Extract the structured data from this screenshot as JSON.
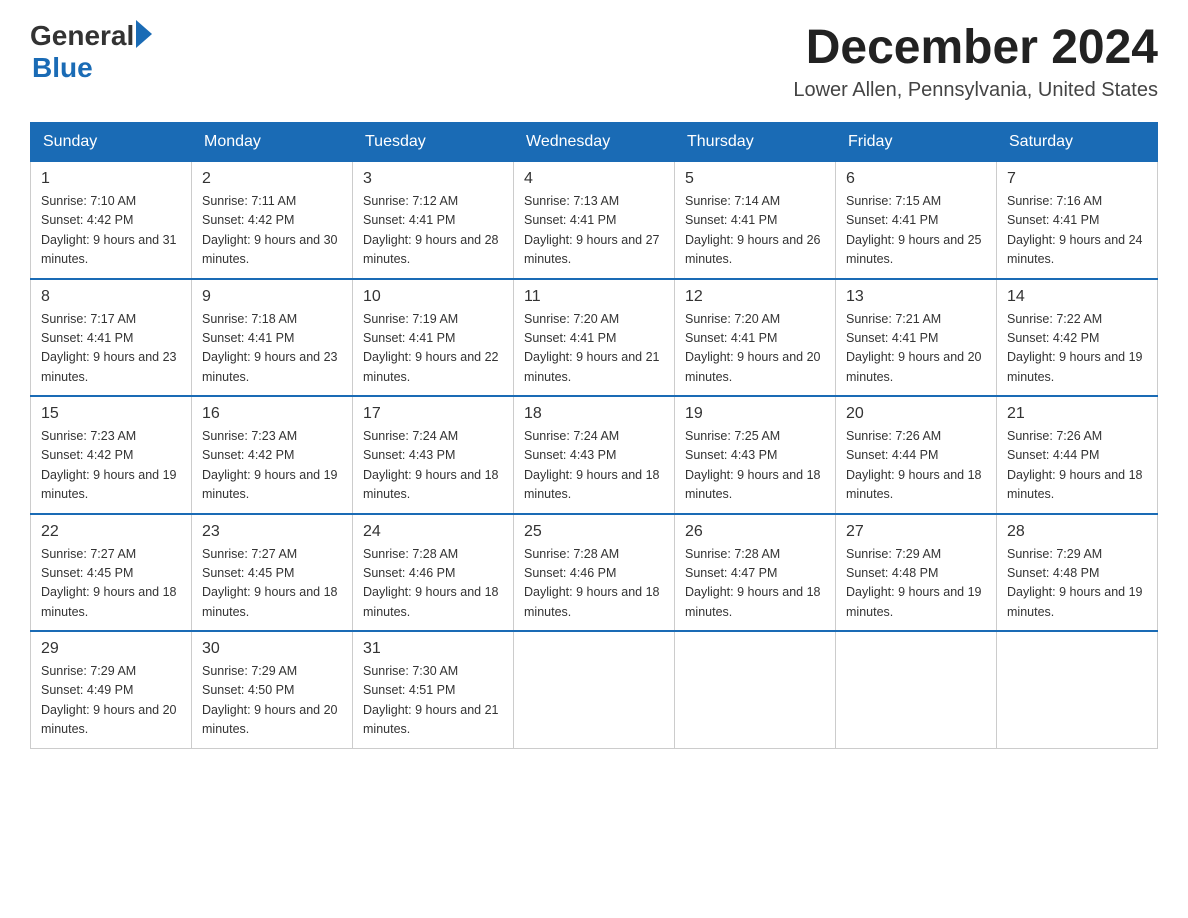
{
  "logo": {
    "general": "General",
    "blue": "Blue"
  },
  "title": {
    "month_year": "December 2024",
    "location": "Lower Allen, Pennsylvania, United States"
  },
  "weekdays": [
    "Sunday",
    "Monday",
    "Tuesday",
    "Wednesday",
    "Thursday",
    "Friday",
    "Saturday"
  ],
  "weeks": [
    [
      {
        "day": "1",
        "sunrise": "7:10 AM",
        "sunset": "4:42 PM",
        "daylight": "9 hours and 31 minutes."
      },
      {
        "day": "2",
        "sunrise": "7:11 AM",
        "sunset": "4:42 PM",
        "daylight": "9 hours and 30 minutes."
      },
      {
        "day": "3",
        "sunrise": "7:12 AM",
        "sunset": "4:41 PM",
        "daylight": "9 hours and 28 minutes."
      },
      {
        "day": "4",
        "sunrise": "7:13 AM",
        "sunset": "4:41 PM",
        "daylight": "9 hours and 27 minutes."
      },
      {
        "day": "5",
        "sunrise": "7:14 AM",
        "sunset": "4:41 PM",
        "daylight": "9 hours and 26 minutes."
      },
      {
        "day": "6",
        "sunrise": "7:15 AM",
        "sunset": "4:41 PM",
        "daylight": "9 hours and 25 minutes."
      },
      {
        "day": "7",
        "sunrise": "7:16 AM",
        "sunset": "4:41 PM",
        "daylight": "9 hours and 24 minutes."
      }
    ],
    [
      {
        "day": "8",
        "sunrise": "7:17 AM",
        "sunset": "4:41 PM",
        "daylight": "9 hours and 23 minutes."
      },
      {
        "day": "9",
        "sunrise": "7:18 AM",
        "sunset": "4:41 PM",
        "daylight": "9 hours and 23 minutes."
      },
      {
        "day": "10",
        "sunrise": "7:19 AM",
        "sunset": "4:41 PM",
        "daylight": "9 hours and 22 minutes."
      },
      {
        "day": "11",
        "sunrise": "7:20 AM",
        "sunset": "4:41 PM",
        "daylight": "9 hours and 21 minutes."
      },
      {
        "day": "12",
        "sunrise": "7:20 AM",
        "sunset": "4:41 PM",
        "daylight": "9 hours and 20 minutes."
      },
      {
        "day": "13",
        "sunrise": "7:21 AM",
        "sunset": "4:41 PM",
        "daylight": "9 hours and 20 minutes."
      },
      {
        "day": "14",
        "sunrise": "7:22 AM",
        "sunset": "4:42 PM",
        "daylight": "9 hours and 19 minutes."
      }
    ],
    [
      {
        "day": "15",
        "sunrise": "7:23 AM",
        "sunset": "4:42 PM",
        "daylight": "9 hours and 19 minutes."
      },
      {
        "day": "16",
        "sunrise": "7:23 AM",
        "sunset": "4:42 PM",
        "daylight": "9 hours and 19 minutes."
      },
      {
        "day": "17",
        "sunrise": "7:24 AM",
        "sunset": "4:43 PM",
        "daylight": "9 hours and 18 minutes."
      },
      {
        "day": "18",
        "sunrise": "7:24 AM",
        "sunset": "4:43 PM",
        "daylight": "9 hours and 18 minutes."
      },
      {
        "day": "19",
        "sunrise": "7:25 AM",
        "sunset": "4:43 PM",
        "daylight": "9 hours and 18 minutes."
      },
      {
        "day": "20",
        "sunrise": "7:26 AM",
        "sunset": "4:44 PM",
        "daylight": "9 hours and 18 minutes."
      },
      {
        "day": "21",
        "sunrise": "7:26 AM",
        "sunset": "4:44 PM",
        "daylight": "9 hours and 18 minutes."
      }
    ],
    [
      {
        "day": "22",
        "sunrise": "7:27 AM",
        "sunset": "4:45 PM",
        "daylight": "9 hours and 18 minutes."
      },
      {
        "day": "23",
        "sunrise": "7:27 AM",
        "sunset": "4:45 PM",
        "daylight": "9 hours and 18 minutes."
      },
      {
        "day": "24",
        "sunrise": "7:28 AM",
        "sunset": "4:46 PM",
        "daylight": "9 hours and 18 minutes."
      },
      {
        "day": "25",
        "sunrise": "7:28 AM",
        "sunset": "4:46 PM",
        "daylight": "9 hours and 18 minutes."
      },
      {
        "day": "26",
        "sunrise": "7:28 AM",
        "sunset": "4:47 PM",
        "daylight": "9 hours and 18 minutes."
      },
      {
        "day": "27",
        "sunrise": "7:29 AM",
        "sunset": "4:48 PM",
        "daylight": "9 hours and 19 minutes."
      },
      {
        "day": "28",
        "sunrise": "7:29 AM",
        "sunset": "4:48 PM",
        "daylight": "9 hours and 19 minutes."
      }
    ],
    [
      {
        "day": "29",
        "sunrise": "7:29 AM",
        "sunset": "4:49 PM",
        "daylight": "9 hours and 20 minutes."
      },
      {
        "day": "30",
        "sunrise": "7:29 AM",
        "sunset": "4:50 PM",
        "daylight": "9 hours and 20 minutes."
      },
      {
        "day": "31",
        "sunrise": "7:30 AM",
        "sunset": "4:51 PM",
        "daylight": "9 hours and 21 minutes."
      },
      null,
      null,
      null,
      null
    ]
  ]
}
